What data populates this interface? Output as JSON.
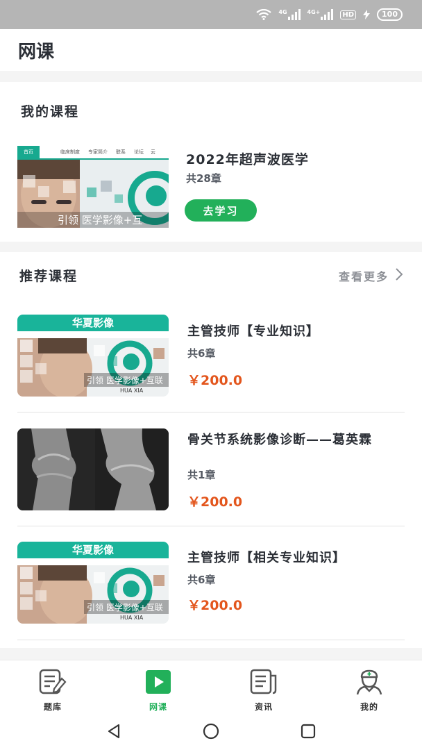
{
  "status": {
    "net1": "4G",
    "net2": "4G+",
    "hd": "HD",
    "battery": "100"
  },
  "header": {
    "title": "网课"
  },
  "my_courses": {
    "title": "我的课程",
    "course": {
      "title": "2022年超声波医学",
      "chapters": "共28章",
      "button": "去学习",
      "thumb_nav": [
        "首页",
        "临床制度",
        "专家简介",
        "联系",
        "论坛",
        "云"
      ],
      "thumb_caption": "引领 医学影像+互"
    }
  },
  "recommended": {
    "title": "推荐课程",
    "more": "查看更多",
    "items": [
      {
        "title": "主管技师【专业知识】",
        "chapters": "共6章",
        "price": "￥200.0",
        "thumb_title": "华夏影像",
        "thumb_caption": "引领 医学影像+互联",
        "thumb_sub": "HUA XIA"
      },
      {
        "title": "骨关节系统影像诊断——葛英霖",
        "chapters": "共1章",
        "price": "￥200.0"
      },
      {
        "title": "主管技师【相关专业知识】",
        "chapters": "共6章",
        "price": "￥200.0",
        "thumb_title": "华夏影像",
        "thumb_caption": "引领 医学影像+互联",
        "thumb_sub": "HUA XIA"
      }
    ]
  },
  "tabs": [
    {
      "label": "题库",
      "icon": "question-bank-icon"
    },
    {
      "label": "网课",
      "icon": "play-video-icon",
      "active": true
    },
    {
      "label": "资讯",
      "icon": "news-icon"
    },
    {
      "label": "我的",
      "icon": "doctor-avatar-icon"
    }
  ],
  "colors": {
    "accent": "#22b05a",
    "price": "#e3561d",
    "banner": "#19b49a"
  }
}
